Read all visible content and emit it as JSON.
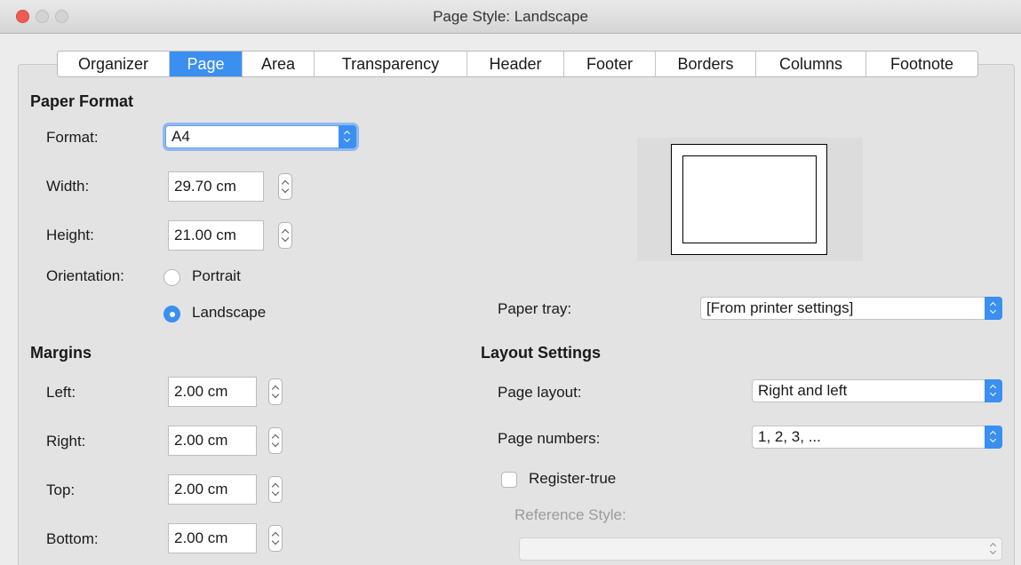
{
  "window": {
    "title": "Page Style: Landscape"
  },
  "tabs": [
    {
      "label": "Organizer",
      "active": false
    },
    {
      "label": "Page",
      "active": true
    },
    {
      "label": "Area",
      "active": false
    },
    {
      "label": "Transparency",
      "active": false
    },
    {
      "label": "Header",
      "active": false
    },
    {
      "label": "Footer",
      "active": false
    },
    {
      "label": "Borders",
      "active": false
    },
    {
      "label": "Columns",
      "active": false
    },
    {
      "label": "Footnote",
      "active": false
    }
  ],
  "paper_format": {
    "title": "Paper Format",
    "format_label": "Format:",
    "format_value": "A4",
    "width_label": "Width:",
    "width_value": "29.70 cm",
    "height_label": "Height:",
    "height_value": "21.00 cm",
    "orientation_label": "Orientation:",
    "portrait_label": "Portrait",
    "landscape_label": "Landscape",
    "orientation_selected": "Landscape"
  },
  "paper_tray": {
    "label": "Paper tray:",
    "value": "[From printer settings]"
  },
  "margins": {
    "title": "Margins",
    "left_label": "Left:",
    "left_value": "2.00 cm",
    "right_label": "Right:",
    "right_value": "2.00 cm",
    "top_label": "Top:",
    "top_value": "2.00 cm",
    "bottom_label": "Bottom:",
    "bottom_value": "2.00 cm"
  },
  "layout_settings": {
    "title": "Layout Settings",
    "page_layout_label": "Page layout:",
    "page_layout_value": "Right and left",
    "page_numbers_label": "Page numbers:",
    "page_numbers_value": "1, 2, 3, ...",
    "register_true_label": "Register-true",
    "register_true_checked": false,
    "reference_style_label": "Reference Style:",
    "reference_style_value": ""
  },
  "colors": {
    "accent": "#3b8ff0",
    "close": "#ee5b55",
    "disabled_text": "#9b9b9b"
  }
}
